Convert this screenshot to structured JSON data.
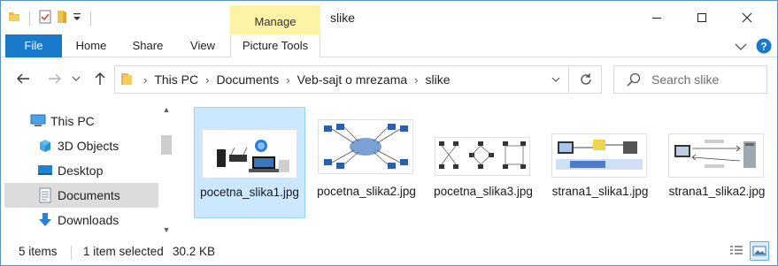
{
  "window": {
    "title": "slike",
    "contextual_group": "Manage"
  },
  "ribbon": {
    "tabs": [
      "File",
      "Home",
      "Share",
      "View",
      "Picture Tools"
    ]
  },
  "address": {
    "crumbs": [
      "This PC",
      "Documents",
      "Veb-sajt o mrezama",
      "slike"
    ]
  },
  "search": {
    "placeholder": "Search slike"
  },
  "nav": {
    "items": [
      {
        "label": "This PC",
        "icon": "computer-icon"
      },
      {
        "label": "3D Objects",
        "icon": "cube-icon"
      },
      {
        "label": "Desktop",
        "icon": "desktop-icon"
      },
      {
        "label": "Documents",
        "icon": "documents-icon"
      },
      {
        "label": "Downloads",
        "icon": "download-arrow-icon"
      }
    ],
    "selected": "Documents"
  },
  "files": [
    {
      "name": "pocetna_slika1.jpg",
      "selected": true
    },
    {
      "name": "pocetna_slika2.jpg",
      "selected": false
    },
    {
      "name": "pocetna_slika3.jpg",
      "selected": false
    },
    {
      "name": "strana1_slika1.jpg",
      "selected": false
    },
    {
      "name": "strana1_slika2.jpg",
      "selected": false
    }
  ],
  "status": {
    "item_count": "5 items",
    "selection": "1 item selected",
    "size": "30.2 KB"
  },
  "colors": {
    "file_tab": "#1979ca",
    "manage": "#fcf3a5",
    "selection": "#cce8ff",
    "help": "#1979ca"
  }
}
